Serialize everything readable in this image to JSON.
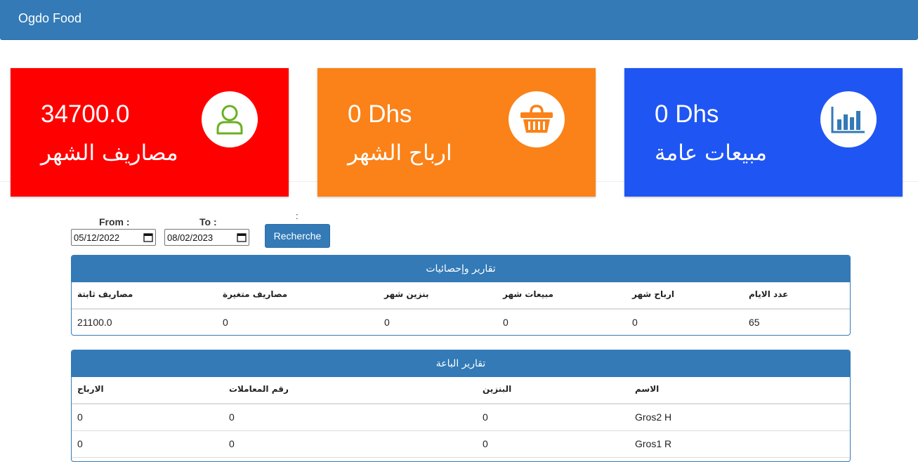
{
  "navbar": {
    "brand": "Ogdo Food"
  },
  "cards": [
    {
      "value": "34700.0",
      "label": "مصاريف الشهر",
      "icon": "user-icon",
      "color": "#ff0000",
      "icon_color": "#6ab023"
    },
    {
      "value": "0 Dhs",
      "label": "ارباح الشهر",
      "icon": "basket-icon",
      "color": "#fa8218",
      "icon_color": "#fa8218"
    },
    {
      "value": "0 Dhs",
      "label": "مبيعات عامة",
      "icon": "bar-chart-icon",
      "color": "#1f56f3",
      "icon_color": "#337ab7"
    }
  ],
  "filter": {
    "from_label": "From :",
    "to_label": "To :",
    "from_value": "05/12/2022",
    "to_value": "08/02/2023",
    "colon": ":",
    "search_button": "Recherche"
  },
  "stats_panel": {
    "title": "تقارير وإحصائيات",
    "headers": [
      "مصاريف ثابتة",
      "مصاريف متغيرة",
      "بنزين شهر",
      "مبيعات شهر",
      "ارباح شهر",
      "عدد الايام"
    ],
    "rows": [
      [
        "21100.0",
        "0",
        "0",
        "0",
        "0",
        "65"
      ]
    ]
  },
  "sellers_panel": {
    "title": "تقارير الباعة",
    "headers": [
      "الارباح",
      "رقم المعاملات",
      "البنزين",
      "الاسم"
    ],
    "rows": [
      [
        "0",
        "0",
        "0",
        "Gros2 H"
      ],
      [
        "0",
        "0",
        "0",
        "Gros1 R"
      ]
    ]
  },
  "colors": {
    "primary": "#337ab7"
  }
}
